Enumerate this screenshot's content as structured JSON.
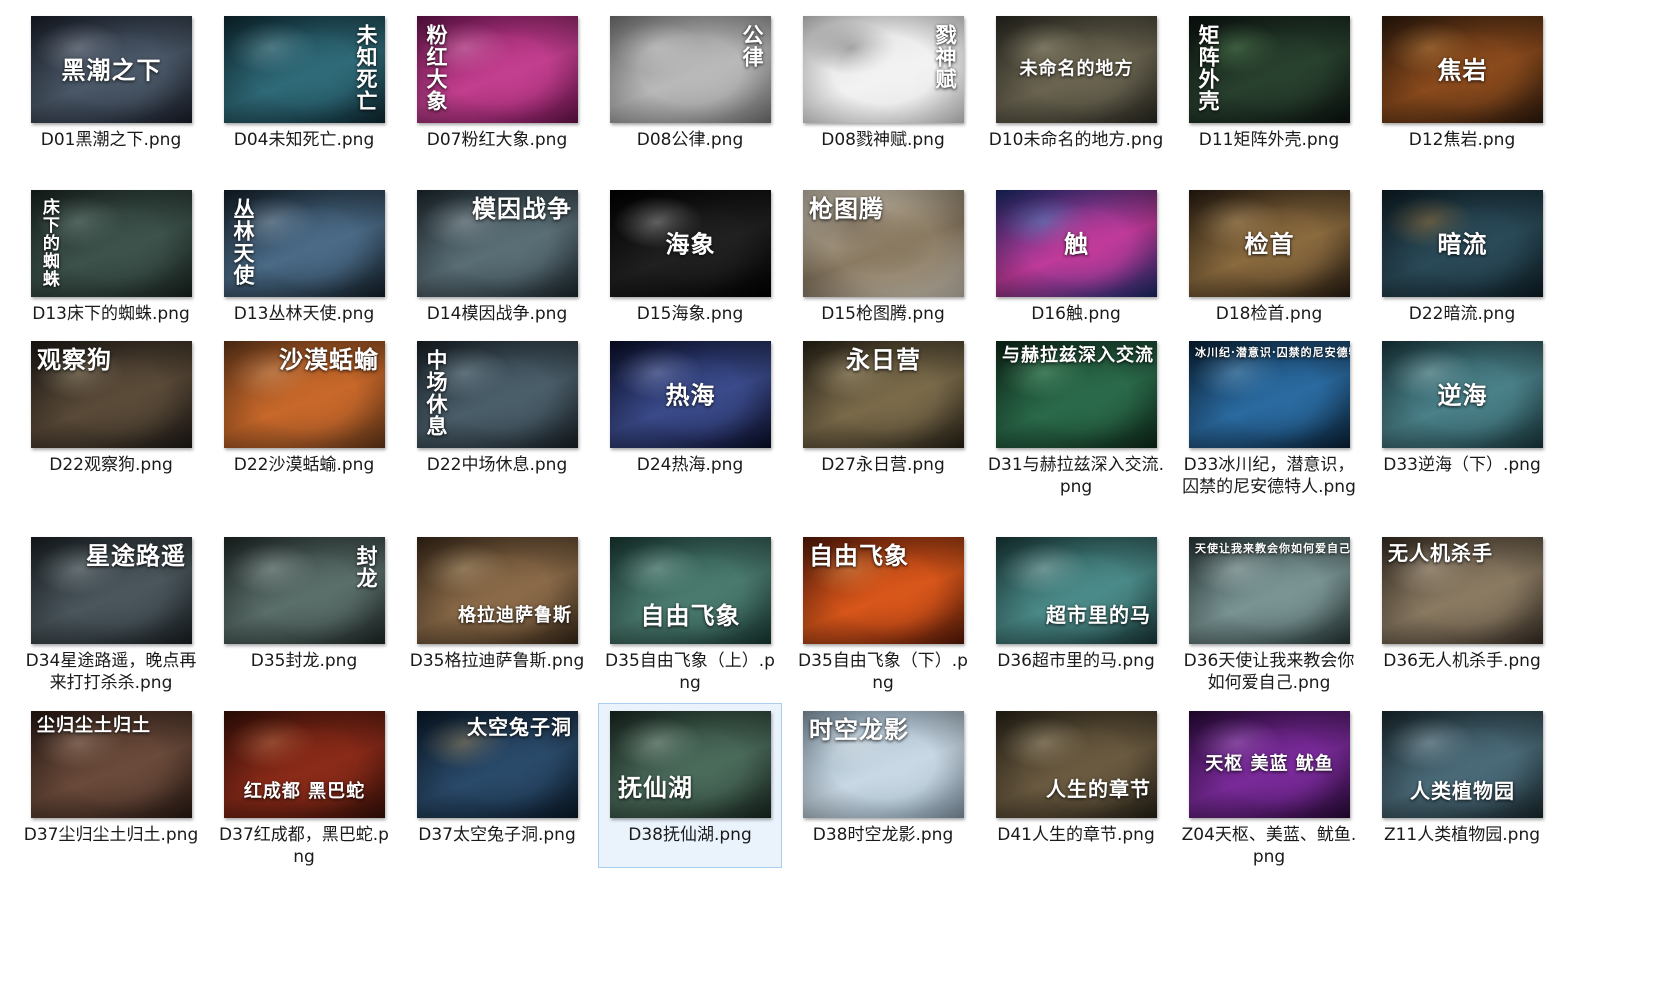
{
  "files": [
    {
      "name": "D01黑潮之下.png",
      "title": "黑潮之下",
      "colors": [
        "#1a1f2a",
        "#4a5868",
        "#c8ccd6"
      ]
    },
    {
      "name": "D04未知死亡.png",
      "title": "未知死亡",
      "colors": [
        "#0e2a33",
        "#2f6a78",
        "#a8d0d6"
      ]
    },
    {
      "name": "D07粉红大象.png",
      "title": "粉红大象",
      "colors": [
        "#6e1450",
        "#c23e8e",
        "#f4b6d8"
      ]
    },
    {
      "name": "D08公律.png",
      "title": "公律",
      "colors": [
        "#7a7a7a",
        "#b9b9b9",
        "#f0f0f0"
      ]
    },
    {
      "name": "D08戮神赋.png",
      "title": "戮神赋",
      "colors": [
        "#d8d8d8",
        "#f2f2f2",
        "#1a1a1a"
      ]
    },
    {
      "name": "D10未命名的地方.png",
      "title": "未命名的地方",
      "colors": [
        "#2b2a22",
        "#6a6450",
        "#d8d0b0"
      ]
    },
    {
      "name": "D11矩阵外壳.png",
      "title": "矩阵外壳",
      "colors": [
        "#0c1410",
        "#28402e",
        "#7ec07a"
      ]
    },
    {
      "name": "D12焦岩.png",
      "title": "焦岩",
      "colors": [
        "#2e1a0c",
        "#8a4a1c",
        "#f0b060"
      ]
    },
    {
      "name": "D13床下的蜘蛛.png",
      "title": "床下的蜘蛛",
      "colors": [
        "#1a2420",
        "#3c524a",
        "#9eb8ae"
      ]
    },
    {
      "name": "D13丛林天使.png",
      "title": "丛林天使",
      "colors": [
        "#14202a",
        "#4a6a86",
        "#c8d8e8"
      ]
    },
    {
      "name": "D14模因战争.png",
      "title": "模因战争",
      "colors": [
        "#1e2a30",
        "#5a6e76",
        "#d8e0e2"
      ]
    },
    {
      "name": "D15海象.png",
      "title": "海象",
      "colors": [
        "#000000",
        "#202020",
        "#ffffff"
      ]
    },
    {
      "name": "D15枪图腾.png",
      "title": "枪图腾",
      "colors": [
        "#c8c0b0",
        "#8a7a62",
        "#3a2e22"
      ]
    },
    {
      "name": "D16触.png",
      "title": "触",
      "colors": [
        "#1a2a6a",
        "#c03a9a",
        "#4ac0e8"
      ]
    },
    {
      "name": "D18检首.png",
      "title": "检首",
      "colors": [
        "#2a1e12",
        "#8a6a3e",
        "#e8c890"
      ]
    },
    {
      "name": "D22暗流.png",
      "title": "暗流",
      "colors": [
        "#0e1e26",
        "#2a4a58",
        "#f0a040"
      ]
    },
    {
      "name": "D22观察狗.png",
      "title": "观察狗",
      "colors": [
        "#1e1a16",
        "#5a4a38",
        "#d8c8a8"
      ]
    },
    {
      "name": "D22沙漠蛞蝓.png",
      "title": "沙漠蛞蝓",
      "colors": [
        "#6a3a1a",
        "#c8682a",
        "#f0c090"
      ]
    },
    {
      "name": "D22中场休息.png",
      "title": "中场休息",
      "colors": [
        "#1a2228",
        "#4a5e6a",
        "#b8d0dc"
      ]
    },
    {
      "name": "D24热海.png",
      "title": "热海",
      "colors": [
        "#0a0e2a",
        "#3a4a8a",
        "#c0d0ff"
      ]
    },
    {
      "name": "D27永日营.png",
      "title": "永日营",
      "colors": [
        "#2a2418",
        "#7a6a4a",
        "#e8d8b0"
      ]
    },
    {
      "name": "D31与赫拉兹深入交流.png",
      "title": "与赫拉兹深入交流",
      "colors": [
        "#0e2a1a",
        "#2a6a4a",
        "#90e0b0"
      ]
    },
    {
      "name": "D33冰川纪，潜意识，囚禁的尼安德特人.png",
      "title": "冰川纪·潜意识·囚禁的尼安德特人",
      "colors": [
        "#0a2238",
        "#2a6aa0",
        "#a0d8ff"
      ]
    },
    {
      "name": "D33逆海（下）.png",
      "title": "逆海",
      "colors": [
        "#1a3a40",
        "#4a8088",
        "#d0f0f0"
      ]
    },
    {
      "name": "D34星途路遥，晚点再来打打杀杀.png",
      "title": "星途路遥",
      "colors": [
        "#1a2024",
        "#4a565c",
        "#c8d2d6"
      ]
    },
    {
      "name": "D35封龙.png",
      "title": "封龙",
      "colors": [
        "#202a28",
        "#5a6e6a",
        "#d8e4e0"
      ]
    },
    {
      "name": "D35格拉迪萨鲁斯.png",
      "title": "格拉迪萨鲁斯",
      "colors": [
        "#3a2a1a",
        "#8a6a48",
        "#e8d0a8"
      ]
    },
    {
      "name": "D35自由飞象（上）.png",
      "title": "自由飞象",
      "colors": [
        "#1a3a34",
        "#4a7a6e",
        "#c8e8e0"
      ]
    },
    {
      "name": "D35自由飞象（下）.png",
      "title": "自由飞象",
      "colors": [
        "#5a1a08",
        "#d8561a",
        "#ffc070"
      ]
    },
    {
      "name": "D36超市里的马.png",
      "title": "超市里的马",
      "colors": [
        "#1a3a3a",
        "#4a8a88",
        "#e0f0f0"
      ]
    },
    {
      "name": "D36天使让我来教会你如何爱自己.png",
      "title": "天使让我来教会你如何爱自己",
      "colors": [
        "#2a3a3a",
        "#7a9494",
        "#f0f8f8"
      ]
    },
    {
      "name": "D36无人机杀手.png",
      "title": "无人机杀手",
      "colors": [
        "#3a3026",
        "#8a7a62",
        "#f0e0c8"
      ]
    },
    {
      "name": "D37尘归尘土归土.png",
      "title": "尘归尘土归土",
      "colors": [
        "#2a1a14",
        "#6a4a3a",
        "#e0c0a8"
      ]
    },
    {
      "name": "D37红成都，黑巴蛇.png",
      "title": "红成都 黑巴蛇",
      "colors": [
        "#3a1008",
        "#8a2a18",
        "#f0a070"
      ]
    },
    {
      "name": "D37太空兔子洞.png",
      "title": "太空兔子洞",
      "colors": [
        "#0a1a2a",
        "#2a4a6a",
        "#f0c070"
      ]
    },
    {
      "name": "D38抚仙湖.png",
      "title": "抚仙湖",
      "colors": [
        "#1a2a22",
        "#4a6a5a",
        "#d8e8dc"
      ]
    },
    {
      "name": "D38时空龙影.png",
      "title": "时空龙影",
      "colors": [
        "#8aa0b0",
        "#c8d8e4",
        "#ffffff"
      ]
    },
    {
      "name": "D41人生的章节.png",
      "title": "人生的章节",
      "colors": [
        "#2a2418",
        "#6a5a40",
        "#e8d8b8"
      ]
    },
    {
      "name": "Z04天枢、美蓝、鱿鱼.png",
      "title": "天枢 美蓝 鱿鱼",
      "colors": [
        "#2a0a3a",
        "#7a2a9a",
        "#e0a0ff"
      ]
    },
    {
      "name": "Z11人类植物园.png",
      "title": "人类植物园",
      "colors": [
        "#1a2a30",
        "#4a6a78",
        "#d8e8f0"
      ]
    }
  ],
  "selected_index": 35
}
